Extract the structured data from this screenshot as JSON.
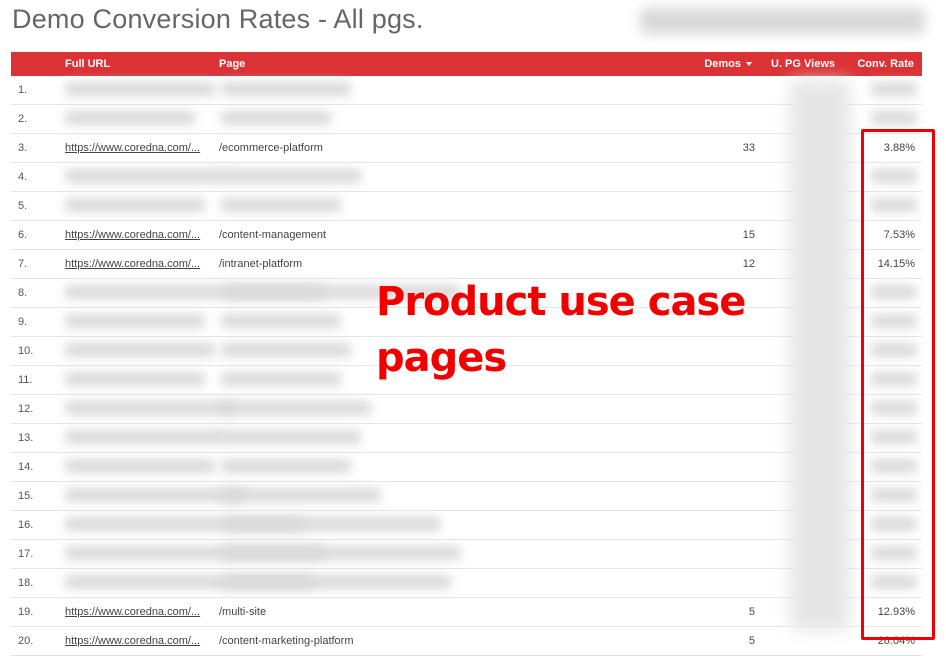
{
  "report": {
    "title": "Demo Conversion Rates - All pgs."
  },
  "table": {
    "columns": {
      "full_url": "Full URL",
      "page": "Page",
      "demos": "Demos",
      "views": "U. PG Views",
      "rate": "Conv. Rate"
    },
    "sort_icon": "caret-down-icon",
    "rows": [
      {
        "idx": "1.",
        "url": "",
        "page": "",
        "demos": "",
        "rate": "",
        "blurred": true
      },
      {
        "idx": "2.",
        "url": "",
        "page": "",
        "demos": "",
        "rate": "",
        "blurred": true
      },
      {
        "idx": "3.",
        "url": "https://www.coredna.com/...",
        "page": "/ecommerce-platform",
        "demos": "33",
        "rate": "3.88%",
        "blurred": false
      },
      {
        "idx": "4.",
        "url": "",
        "page": "",
        "demos": "",
        "rate": "",
        "blurred": true
      },
      {
        "idx": "5.",
        "url": "",
        "page": "",
        "demos": "",
        "rate": "",
        "blurred": true
      },
      {
        "idx": "6.",
        "url": "https://www.coredna.com/...",
        "page": "/content-management",
        "demos": "15",
        "rate": "7.53%",
        "blurred": false
      },
      {
        "idx": "7.",
        "url": "https://www.coredna.com/...",
        "page": "/intranet-platform",
        "demos": "12",
        "rate": "14.15%",
        "blurred": false
      },
      {
        "idx": "8.",
        "url": "",
        "page": "",
        "demos": "",
        "rate": "",
        "blurred": true
      },
      {
        "idx": "9.",
        "url": "",
        "page": "",
        "demos": "",
        "rate": "",
        "blurred": true
      },
      {
        "idx": "10.",
        "url": "",
        "page": "",
        "demos": "",
        "rate": "",
        "blurred": true
      },
      {
        "idx": "11.",
        "url": "",
        "page": "",
        "demos": "",
        "rate": "",
        "blurred": true
      },
      {
        "idx": "12.",
        "url": "",
        "page": "",
        "demos": "",
        "rate": "",
        "blurred": true
      },
      {
        "idx": "13.",
        "url": "",
        "page": "",
        "demos": "",
        "rate": "",
        "blurred": true
      },
      {
        "idx": "14.",
        "url": "",
        "page": "",
        "demos": "",
        "rate": "",
        "blurred": true
      },
      {
        "idx": "15.",
        "url": "",
        "page": "",
        "demos": "",
        "rate": "",
        "blurred": true
      },
      {
        "idx": "16.",
        "url": "",
        "page": "",
        "demos": "",
        "rate": "",
        "blurred": true
      },
      {
        "idx": "17.",
        "url": "",
        "page": "",
        "demos": "",
        "rate": "",
        "blurred": true
      },
      {
        "idx": "18.",
        "url": "",
        "page": "",
        "demos": "",
        "rate": "",
        "blurred": true
      },
      {
        "idx": "19.",
        "url": "https://www.coredna.com/...",
        "page": "/multi-site",
        "demos": "5",
        "rate": "12.93%",
        "blurred": false
      },
      {
        "idx": "20.",
        "url": "https://www.coredna.com/...",
        "page": "/content-marketing-platform",
        "demos": "5",
        "rate": "26.04%",
        "blurred": false
      }
    ]
  },
  "annotation": {
    "text": "Product use case pages",
    "color": "#f20000"
  },
  "colors": {
    "header_bg": "#db3236",
    "annotation": "#f00000"
  }
}
